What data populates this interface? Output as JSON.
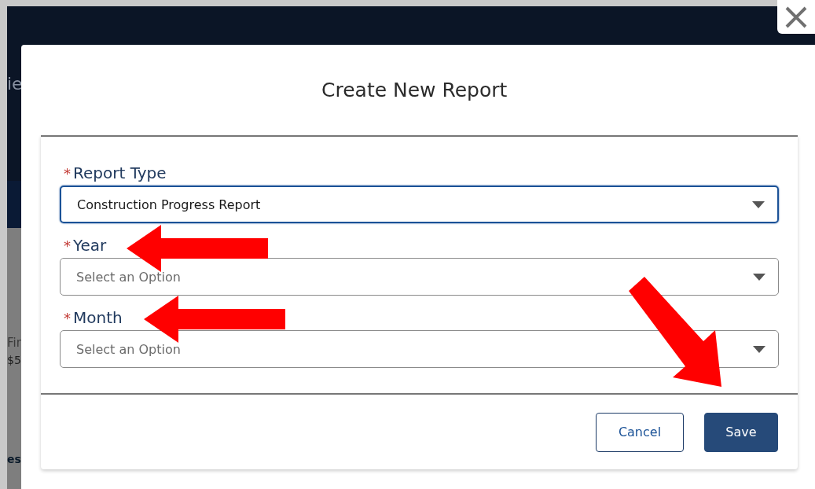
{
  "background": {
    "fragments": [
      {
        "kind": "heading",
        "text": "ie"
      },
      {
        "kind": "label",
        "text": "Fin"
      },
      {
        "kind": "value",
        "text": "$5"
      },
      {
        "kind": "section",
        "text": "es"
      }
    ]
  },
  "modal": {
    "title": "Create New Report",
    "fields": [
      {
        "label": "Report Type",
        "required": true,
        "marker": "*",
        "value": "Construction Progress Report",
        "focused": true
      },
      {
        "label": "Year",
        "required": true,
        "marker": "*",
        "placeholder": "Select an Option",
        "focused": false
      },
      {
        "label": "Month",
        "required": true,
        "marker": "*",
        "placeholder": "Select an Option",
        "focused": false
      }
    ],
    "buttons": [
      {
        "label": "Cancel",
        "kind": "neutral"
      },
      {
        "label": "Save",
        "kind": "brand"
      }
    ]
  }
}
